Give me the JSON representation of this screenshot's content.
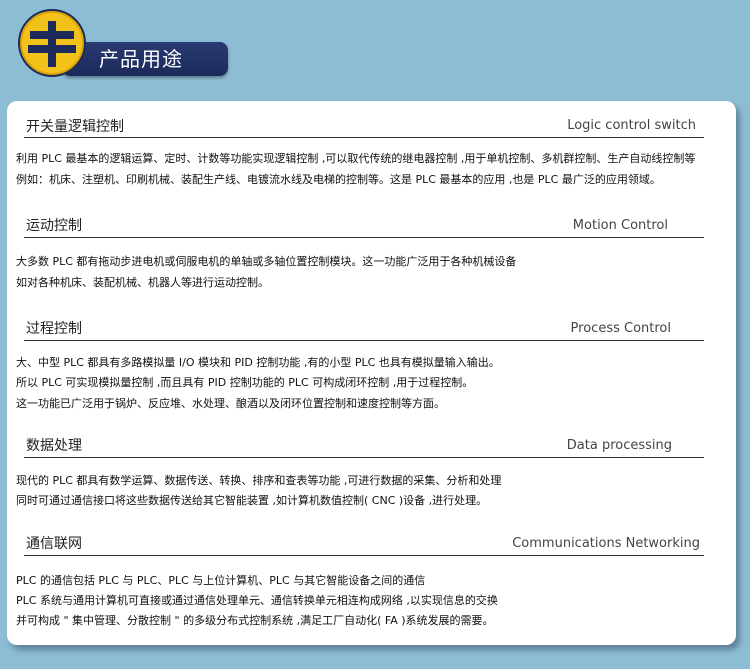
{
  "header": {
    "title": "产品用途",
    "logo_icon": "yellow-circle-emblem-icon"
  },
  "colors": {
    "background": "#8dbdd5",
    "banner": "#1f2e63",
    "logo": "#f2c21a",
    "panel": "#ffffff"
  },
  "sections": [
    {
      "title_cn": "开关量逻辑控制",
      "title_en": "Logic control switch",
      "lines": [
        "利用 PLC 最基本的逻辑运算、定时、计数等功能实现逻辑控制 ,可以取代传统的继电器控制 ,用于单机控制、多机群控制、生产自动线控制等",
        "例如：机床、注塑机、印刷机械、装配生产线、电镀流水线及电梯的控制等。这是 PLC 最基本的应用 ,也是 PLC 最广泛的应用领域。"
      ]
    },
    {
      "title_cn": "运动控制",
      "title_en": "Motion Control",
      "lines": [
        "大多数 PLC 都有拖动步进电机或伺服电机的单轴或多轴位置控制模块。这一功能广泛用于各种机械设备",
        "如对各种机床、装配机械、机器人等进行运动控制。"
      ]
    },
    {
      "title_cn": "过程控制",
      "title_en": "Process Control",
      "lines": [
        "大、中型 PLC 都具有多路模拟量 I/O 模块和 PID 控制功能 ,有的小型 PLC 也具有模拟量输入输出。",
        "所以 PLC 可实现模拟量控制 ,而且具有 PID 控制功能的 PLC 可构成闭环控制 ,用于过程控制。",
        "这一功能已广泛用于锅炉、反应堆、水处理、酿酒以及闭环位置控制和速度控制等方面。"
      ]
    },
    {
      "title_cn": "数据处理",
      "title_en": "Data processing",
      "lines": [
        "现代的 PLC 都具有数学运算、数据传送、转换、排序和查表等功能 ,可进行数据的采集、分析和处理",
        "同时可通过通信接口将这些数据传送给其它智能装置 ,如计算机数值控制( CNC )设备 ,进行处理。"
      ]
    },
    {
      "title_cn": "通信联网",
      "title_en": "Communications Networking",
      "lines": [
        "PLC 的通信包括 PLC 与 PLC、PLC 与上位计算机、PLC 与其它智能设备之间的通信",
        "PLC 系统与通用计算机可直接或通过通信处理单元、通信转换单元相连构成网络 ,以实现信息的交换",
        "并可构成 \" 集中管理、分散控制 \" 的多级分布式控制系统 ,满足工厂自动化( FA )系统发展的需要。"
      ]
    }
  ]
}
